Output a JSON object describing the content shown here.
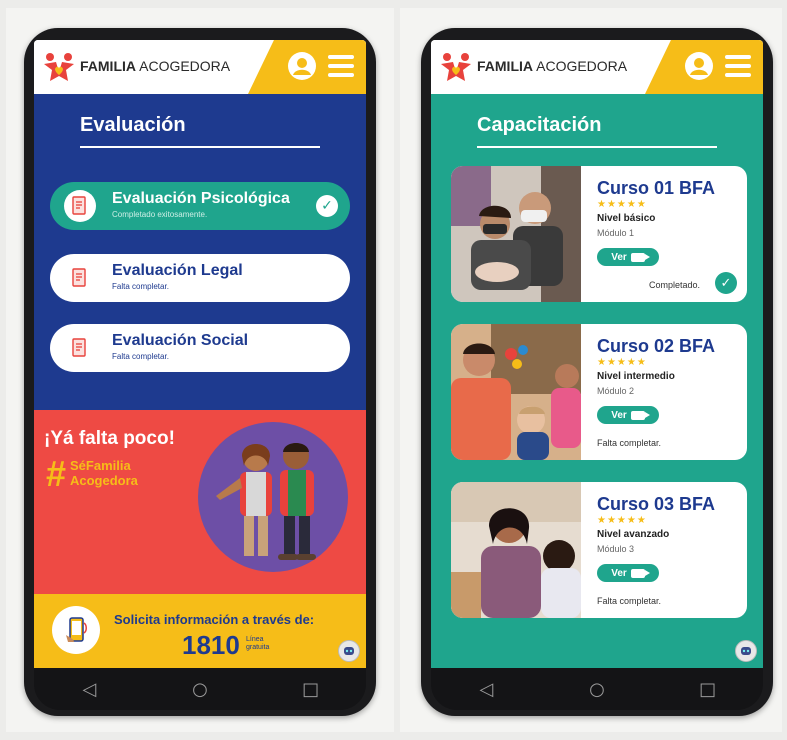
{
  "left_screen": {
    "brand": {
      "bold": "FAMILIA",
      "rest": " ACOGEDORA"
    },
    "section_title": "Evaluación",
    "evaluations": [
      {
        "title": "Evaluación Psicológica",
        "status": "Completado exitosamente.",
        "completed": true
      },
      {
        "title": "Evaluación Legal",
        "status": "Falta completar.",
        "completed": false
      },
      {
        "title": "Evaluación Social",
        "status": "Falta completar.",
        "completed": false
      }
    ],
    "promo": {
      "title": "¡Yá falta poco!",
      "hash": "#",
      "tag_line1": "SéFamilia",
      "tag_line2": "Acogedora"
    },
    "footer": {
      "prefix": "Solicita ",
      "bold": "información",
      "suffix": " a través de:",
      "number": "1810",
      "note_line1": "Línea",
      "note_line2": "gratuita"
    },
    "bot_label": "ayuda"
  },
  "right_screen": {
    "brand": {
      "bold": "FAMILIA",
      "rest": " ACOGEDORA"
    },
    "section_title": "Capacitación",
    "courses": [
      {
        "title": "Curso 01 BFA",
        "stars": "★★★★★",
        "level": "Nivel básico",
        "module": "Módulo 1",
        "button": "Ver",
        "status": "Completado.",
        "completed": true
      },
      {
        "title": "Curso 02 BFA",
        "stars": "★★★★★",
        "level": "Nivel intermedio",
        "module": "Módulo 2",
        "button": "Ver",
        "status": "Falta completar.",
        "completed": false
      },
      {
        "title": "Curso 03 BFA",
        "stars": "★★★★★",
        "level": "Nivel avanzado",
        "module": "Módulo 3",
        "button": "Ver",
        "status": "Falta completar.",
        "completed": false
      }
    ],
    "bot_label": "ayuda"
  },
  "navbar": {
    "back": "◁",
    "home": "○",
    "recents": "□"
  },
  "colors": {
    "blue": "#1e3a8f",
    "teal": "#1fa58d",
    "yellow": "#f6bd18",
    "red": "#ee4a44"
  }
}
